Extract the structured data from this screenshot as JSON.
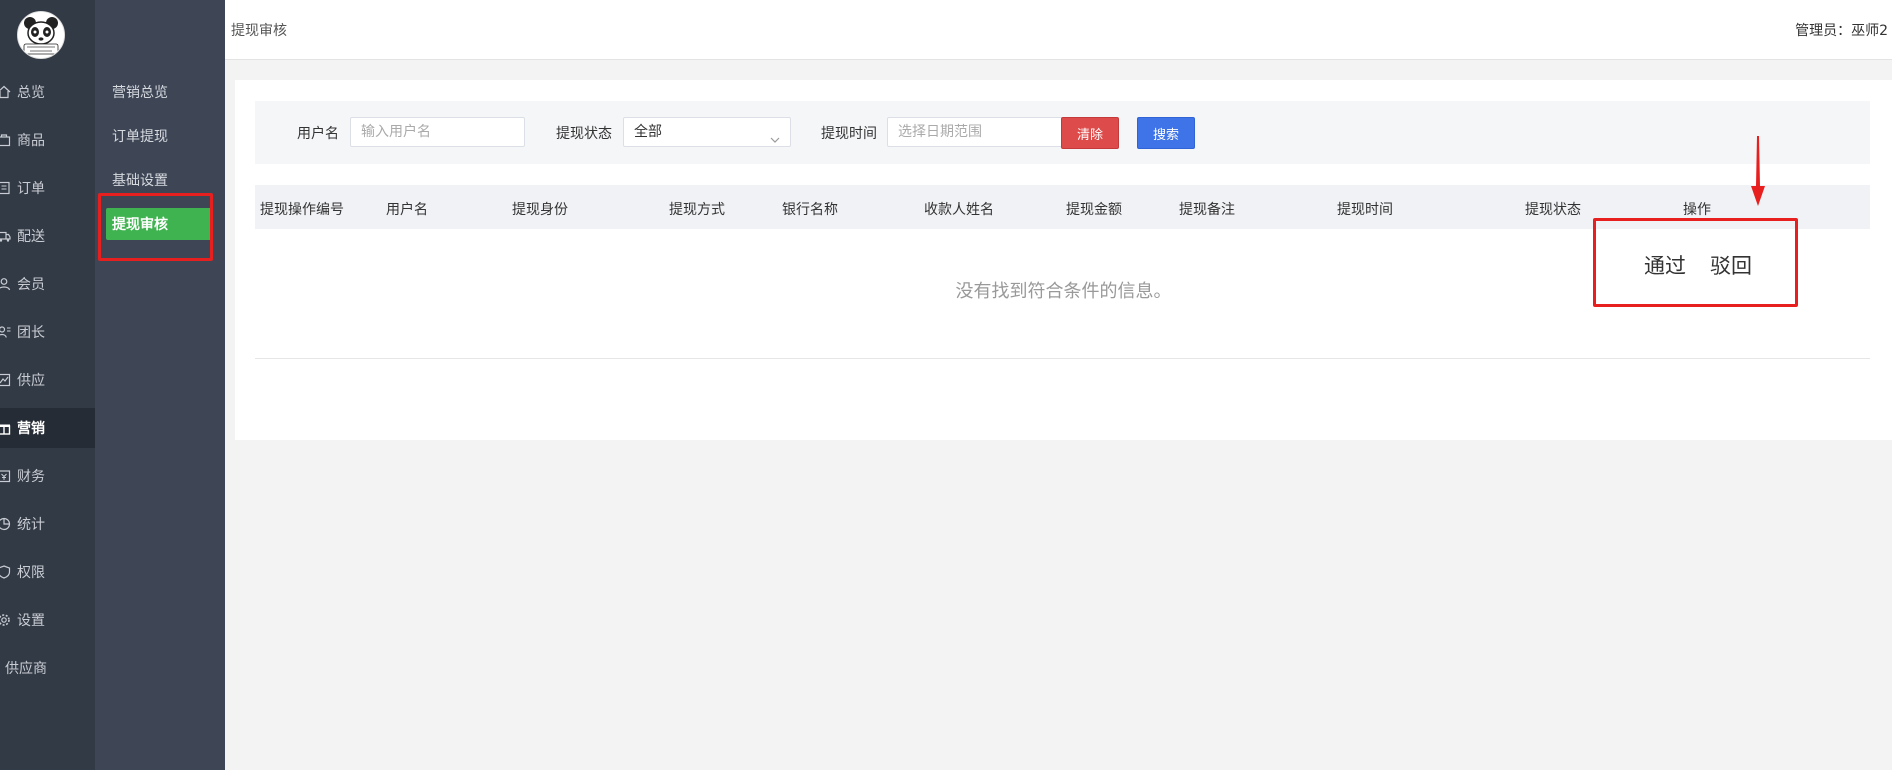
{
  "rail": {
    "items": [
      {
        "label": "总览",
        "icon": "home-icon"
      },
      {
        "label": "商品",
        "icon": "goods-icon"
      },
      {
        "label": "订单",
        "icon": "order-icon"
      },
      {
        "label": "配送",
        "icon": "delivery-icon"
      },
      {
        "label": "会员",
        "icon": "member-icon"
      },
      {
        "label": "团长",
        "icon": "leader-icon"
      },
      {
        "label": "供应",
        "icon": "supply-icon"
      },
      {
        "label": "营销",
        "icon": "gift-icon",
        "active": true
      },
      {
        "label": "财务",
        "icon": "finance-icon"
      },
      {
        "label": "统计",
        "icon": "chart-icon"
      },
      {
        "label": "权限",
        "icon": "permission-icon"
      },
      {
        "label": "设置",
        "icon": "gear-icon"
      },
      {
        "label": "供应商",
        "icon": ""
      }
    ]
  },
  "submenu": {
    "items": [
      {
        "label": "营销总览"
      },
      {
        "label": "订单提现"
      },
      {
        "label": "基础设置"
      },
      {
        "label": "提现审核",
        "active": true
      }
    ]
  },
  "header": {
    "breadcrumb": "提现审核",
    "admin_label": "管理员：",
    "admin_name": "巫师2"
  },
  "search": {
    "username_label": "用户名",
    "username_placeholder": "输入用户名",
    "status_label": "提现状态",
    "status_value": "全部",
    "time_label": "提现时间",
    "time_placeholder": "选择日期范围",
    "clear_label": "清除",
    "search_label": "搜索"
  },
  "table": {
    "columns": [
      "提现操作编号",
      "用户名",
      "提现身份",
      "提现方式",
      "银行名称",
      "收款人姓名",
      "提现金额",
      "提现备注",
      "提现时间",
      "提现状态",
      "操作"
    ],
    "empty_text": "没有找到符合条件的信息。"
  },
  "annotation": {
    "approve_label": "通过",
    "reject_label": "驳回"
  },
  "colors": {
    "accent_green": "#3fb34f",
    "annotation_red": "#e81f1f",
    "search_blue": "#3f74e8",
    "clear_red": "#dd4b4b"
  }
}
